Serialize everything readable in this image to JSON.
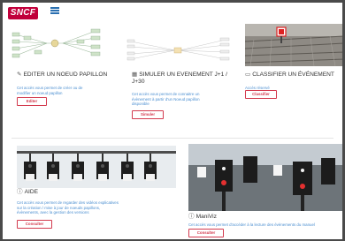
{
  "brand": {
    "logo_text": "SNCF",
    "accent": "#c1003b",
    "link_color": "#4a8ed0"
  },
  "header": {
    "menu_icon": "hamburger-icon"
  },
  "cards": [
    {
      "title": "EDITER UN NOEUD PAPILLON",
      "icon": "edit-icon",
      "desc": "Cet accès vous permet de créer ou de modifier un noeud papillon",
      "button": "Editer"
    },
    {
      "title": "SIMULER UN EVENEMENT J+1 / J+30",
      "icon": "calendar-icon",
      "desc": "Cet accès vous permet de connaitre un évènement à partir d'un Noeud papillon disponible",
      "button": "Simuler"
    },
    {
      "title": "CLASSIFIER UN ÉVÉNEMENT",
      "icon": "folder-icon",
      "desc": "Accès réservé",
      "button": "Classifier"
    },
    {
      "title": "AIDE",
      "icon": "help-icon",
      "desc": "Cet accès vous permet de regarder des vidéos explicatives sur la création / mise à jour de noeuds papillons, évènements, avec la gestion des versions",
      "button": "Consulter"
    },
    {
      "title": "ManiViz",
      "icon": "help-icon",
      "desc": "Cet accès vous permet d'accéder à la lecture des évènements du manuel",
      "button": "Consulter"
    }
  ]
}
